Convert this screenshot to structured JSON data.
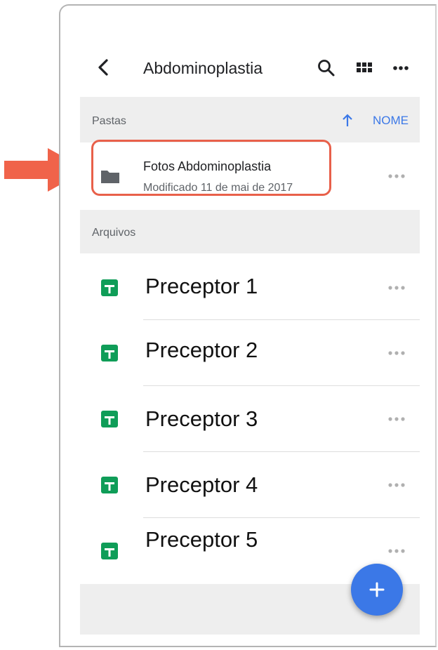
{
  "header": {
    "title": "Abdominoplastia",
    "back_icon": "chevron-left-icon",
    "search_icon": "search-icon",
    "grid_icon": "grid-view-icon",
    "more_icon": "more-horizontal-icon"
  },
  "folders_section": {
    "label": "Pastas",
    "sort_label": "NOME",
    "sort_icon": "arrow-up-icon"
  },
  "folders": [
    {
      "name": "Fotos Abdominoplastia",
      "meta": "Modificado 11 de mai de 2017",
      "icon": "folder-icon"
    }
  ],
  "files_section": {
    "label": "Arquivos"
  },
  "files": [
    {
      "name": "Preceptor 1",
      "icon": "google-sheets-icon"
    },
    {
      "name": "Preceptor 2",
      "icon": "google-sheets-icon"
    },
    {
      "name": "Preceptor 3",
      "icon": "google-sheets-icon"
    },
    {
      "name": "Preceptor 4",
      "icon": "google-sheets-icon"
    },
    {
      "name": "Preceptor 5",
      "icon": "google-sheets-icon"
    }
  ],
  "fab_icon": "plus-icon",
  "colors": {
    "accent": "#3b78e7",
    "sheets_green": "#0f9d58",
    "highlight": "#e8604a",
    "section_bg": "#eeeeee"
  }
}
